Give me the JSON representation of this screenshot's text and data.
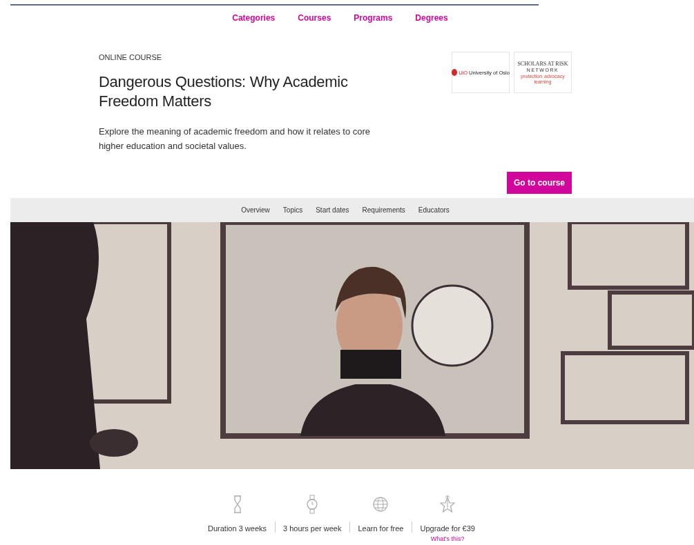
{
  "top_nav": [
    {
      "label": "Categories"
    },
    {
      "label": "Courses"
    },
    {
      "label": "Programs"
    },
    {
      "label": "Degrees"
    }
  ],
  "course": {
    "eyebrow": "ONLINE COURSE",
    "title": "Dangerous Questions: Why Academic Freedom Matters",
    "description": "Explore the meaning of academic freedom and how it relates to core higher education and societal values.",
    "cta": "Go to course"
  },
  "partners": [
    {
      "kind": "seal",
      "mark": "UiO",
      "name": "University of Oslo"
    },
    {
      "kind": "network",
      "name": "SCHOLARS AT RISK",
      "subtitle": "NETWORK",
      "tags": [
        "protection",
        "advocacy",
        "learning"
      ]
    }
  ],
  "section_tabs": [
    {
      "label": "Overview"
    },
    {
      "label": "Topics"
    },
    {
      "label": "Start dates"
    },
    {
      "label": "Requirements"
    },
    {
      "label": "Educators"
    }
  ],
  "facts": [
    {
      "kind": "hourglass",
      "text": "Duration 3 weeks"
    },
    {
      "kind": "watch",
      "text": "3 hours per week"
    },
    {
      "kind": "globe",
      "text": "Learn for free"
    },
    {
      "kind": "star",
      "text": "Upgrade for €39",
      "link": "What's this?"
    }
  ]
}
